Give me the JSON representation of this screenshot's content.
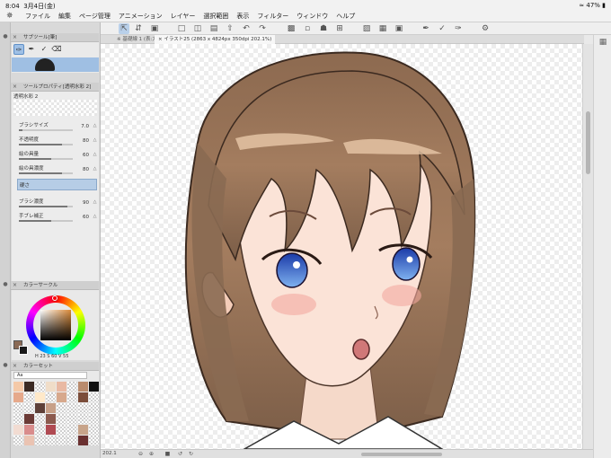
{
  "status": {
    "time": "8:04",
    "date": "3月4日(金)",
    "battery": "47%"
  },
  "menu": [
    "ファイル",
    "編集",
    "ページ管理",
    "アニメーション",
    "レイヤー",
    "選択範囲",
    "表示",
    "フィルター",
    "ウィンドウ",
    "ヘルプ"
  ],
  "tabs": {
    "tab1": "※ 基礎線 1 (表:大) *",
    "tab2": "× イラスト25 (2863 x 4824px 350dpi 202.1%)"
  },
  "subtool_panel": {
    "title": "サブツール[筆]"
  },
  "tool_property": {
    "title": "ツールプロパティ[透明水彩 2]",
    "subtool_name": "透明水彩 2",
    "rows": [
      {
        "label": "ブラシサイズ",
        "value": "7.0",
        "fill": 0.07
      },
      {
        "label": "不透明度",
        "value": "80",
        "fill": 0.8
      },
      {
        "label": "絵の具量",
        "value": "60",
        "fill": 0.6
      },
      {
        "label": "絵の具濃度",
        "value": "80",
        "fill": 0.8
      },
      {
        "label": "色延び",
        "value": "70",
        "fill": 0.7
      }
    ],
    "hardness_label": "硬さ",
    "rows2": [
      {
        "label": "ブラシ濃度",
        "value": "90",
        "fill": 0.9
      },
      {
        "label": "手ブレ補正",
        "value": "60",
        "fill": 0.6
      }
    ]
  },
  "color_wheel": {
    "title": "カラーサークル",
    "hsv": "H 23  S 60  V 55"
  },
  "color_set": {
    "title": "カラーセット",
    "selected": "Aa",
    "colors": [
      "#f4c9a8",
      "#3b2a24",
      "#ffffff",
      "#f0ddc8",
      "#e9b9a3",
      "#ffffff",
      "#b98b6d",
      "#111111",
      "#e6a98b",
      "#ffffff",
      "#ffe9c9",
      "#ffffff",
      "#d7a88c",
      "#ffffff",
      "#7b4d3a",
      "#ffffff",
      "#ffffff",
      "#ffffff",
      "#5e4038",
      "#c7a088",
      "#ffffff",
      "#ffffff",
      "#ffffff",
      "#ffffff",
      "#ffffff",
      "#6b3a36",
      "#ffffff",
      "#8b5a4e",
      "#ffffff",
      "#ffffff",
      "#ffffff",
      "#ffffff",
      "#f2dcd2",
      "#d98c8c",
      "#ffffff",
      "#b04a52",
      "#ffffff",
      "#ffffff",
      "#c8a48a",
      "#ffffff",
      "#ffffff",
      "#eac3b2",
      "#ffffff",
      "#ffffff",
      "#ffffff",
      "#ffffff",
      "#6a3030",
      "#ffffff"
    ]
  },
  "bottom": {
    "zoom": "202.1"
  },
  "accent": "#9fc0e6"
}
